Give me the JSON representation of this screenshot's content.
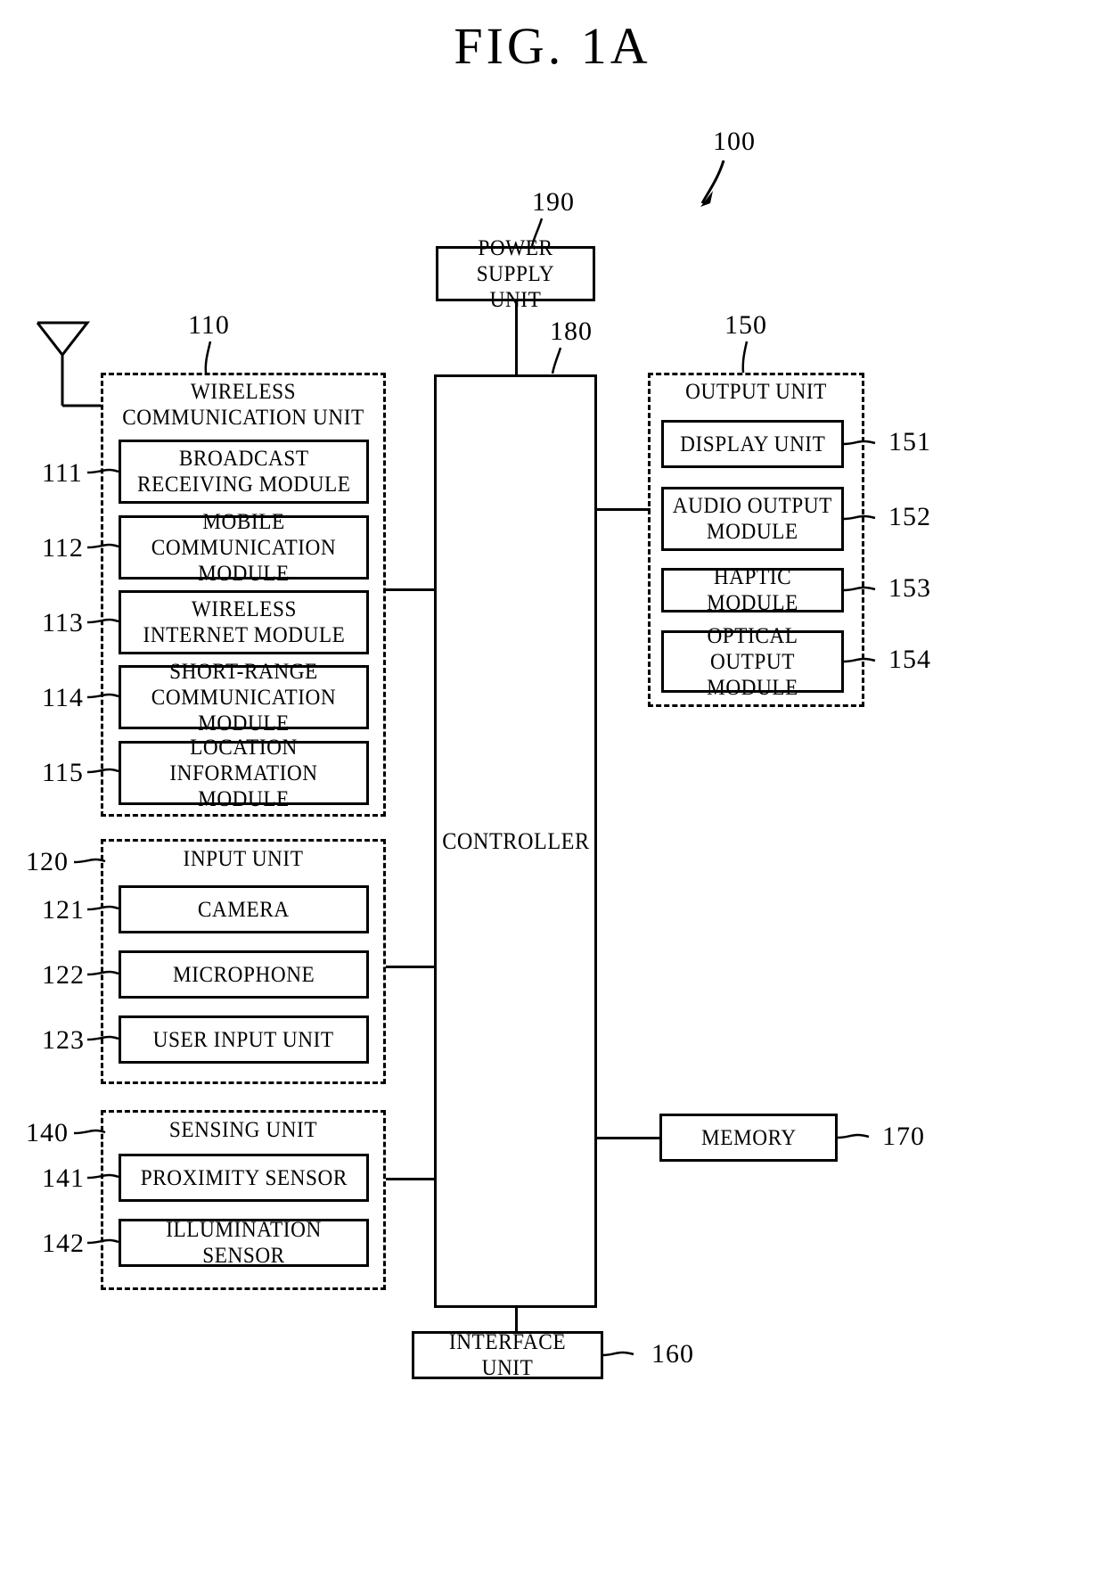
{
  "figure": {
    "title": "FIG.  1A",
    "device_ref": "100"
  },
  "power_supply": {
    "ref": "190",
    "label": "POWER SUPPLY\nUNIT"
  },
  "controller": {
    "ref": "180",
    "label": "CONTROLLER"
  },
  "wireless_communication_unit": {
    "ref": "110",
    "title": "WIRELESS\nCOMMUNICATION UNIT",
    "modules": [
      {
        "ref": "111",
        "label": "BROADCAST\nRECEIVING MODULE"
      },
      {
        "ref": "112",
        "label": "MOBILE\nCOMMUNICATION MODULE"
      },
      {
        "ref": "113",
        "label": "WIRELESS\nINTERNET MODULE"
      },
      {
        "ref": "114",
        "label": "SHORT-RANGE\nCOMMUNICATION MODULE"
      },
      {
        "ref": "115",
        "label": "LOCATION\nINFORMATION MODULE"
      }
    ]
  },
  "input_unit": {
    "ref": "120",
    "title": "INPUT UNIT",
    "modules": [
      {
        "ref": "121",
        "label": "CAMERA"
      },
      {
        "ref": "122",
        "label": "MICROPHONE"
      },
      {
        "ref": "123",
        "label": "USER INPUT UNIT"
      }
    ]
  },
  "sensing_unit": {
    "ref": "140",
    "title": "SENSING UNIT",
    "modules": [
      {
        "ref": "141",
        "label": "PROXIMITY SENSOR"
      },
      {
        "ref": "142",
        "label": "ILLUMINATION SENSOR"
      }
    ]
  },
  "output_unit": {
    "ref": "150",
    "title": "OUTPUT UNIT",
    "modules": [
      {
        "ref": "151",
        "label": "DISPLAY UNIT"
      },
      {
        "ref": "152",
        "label": "AUDIO OUTPUT\nMODULE"
      },
      {
        "ref": "153",
        "label": "HAPTIC MODULE"
      },
      {
        "ref": "154",
        "label": "OPTICAL OUTPUT\nMODULE"
      }
    ]
  },
  "memory": {
    "ref": "170",
    "label": "MEMORY"
  },
  "interface_unit": {
    "ref": "160",
    "label": "INTERFACE UNIT"
  },
  "antenna": {
    "name": "antenna-symbol"
  },
  "colors": {
    "line": "#000000",
    "background": "#ffffff"
  }
}
